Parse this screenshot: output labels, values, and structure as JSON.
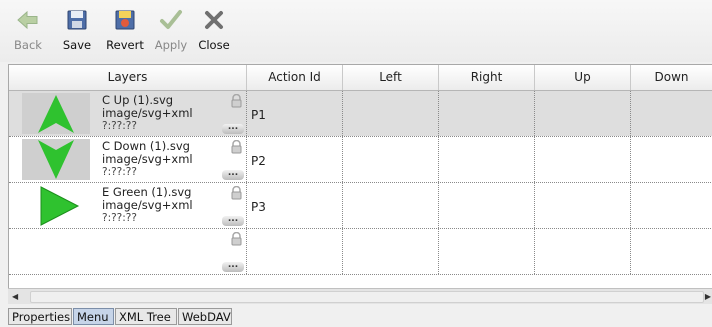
{
  "toolbar": {
    "back": {
      "label": "Back",
      "enabled": false
    },
    "save": {
      "label": "Save",
      "enabled": true
    },
    "revert": {
      "label": "Revert",
      "enabled": true
    },
    "apply": {
      "label": "Apply",
      "enabled": false
    },
    "close": {
      "label": "Close",
      "enabled": true
    }
  },
  "grid": {
    "columns": [
      "Layers",
      "Action Id",
      "Left",
      "Right",
      "Up",
      "Down"
    ],
    "rows": [
      {
        "file": "C Up (1).svg",
        "type": "image/svg+xml",
        "time": "?:??:??",
        "action_id": "P1",
        "icon": "triangle-up-icon",
        "selected": true
      },
      {
        "file": "C Down (1).svg",
        "type": "image/svg+xml",
        "time": "?:??:??",
        "action_id": "P2",
        "icon": "triangle-down-icon",
        "selected": false
      },
      {
        "file": "E Green (1).svg",
        "type": "image/svg+xml",
        "time": "?:??:??",
        "action_id": "P3",
        "icon": "triangle-right-icon",
        "selected": false
      },
      {
        "file": "",
        "type": "",
        "time": "",
        "action_id": "",
        "icon": "",
        "selected": false
      }
    ],
    "more_label": "...",
    "arrow_color": "#2fc22f"
  },
  "tabs": [
    "Properties",
    "Menu",
    "XML Tree",
    "WebDAV"
  ],
  "active_tab": "Menu"
}
